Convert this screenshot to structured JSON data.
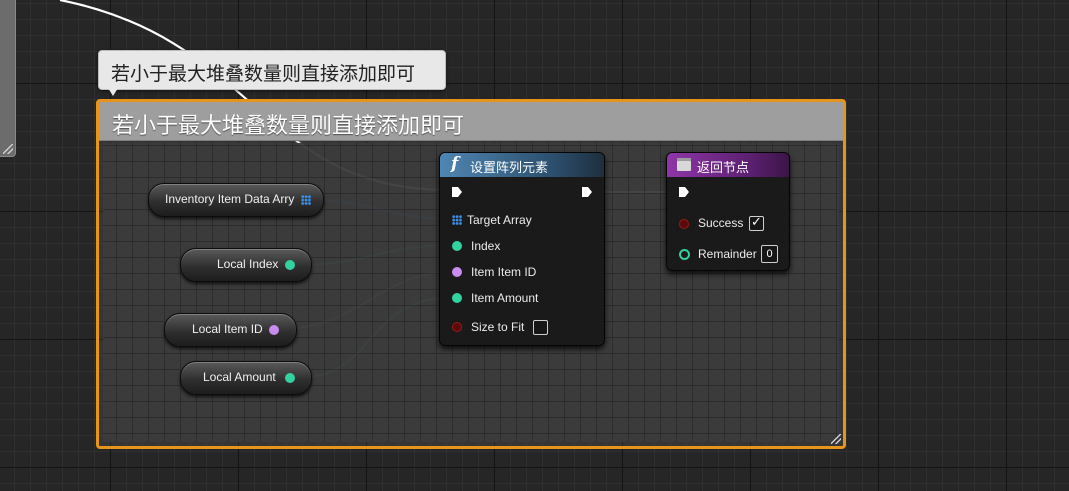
{
  "comment": {
    "bubble_text": "若小于最大堆叠数量则直接添加即可",
    "header_text": "若小于最大堆叠数量则直接添加即可",
    "frame_color": "#e6951c"
  },
  "variables": [
    {
      "label": "Inventory Item Data Arry",
      "pin_type": "array",
      "color": "#3b8fe6"
    },
    {
      "label": "Local Index",
      "pin_type": "integer",
      "color": "#34d1a0"
    },
    {
      "label": "Local Item ID",
      "pin_type": "byte",
      "color": "#c88cf0"
    },
    {
      "label": "Local Amount",
      "pin_type": "integer",
      "color": "#34d1a0"
    }
  ],
  "set_array_elem_node": {
    "title": "设置阵列元素",
    "icon": "function-icon",
    "header_color": "#3e6e96",
    "pins": [
      "Target Array",
      "Index",
      "Item Item ID",
      "Item Amount",
      "Size to Fit"
    ],
    "size_to_fit": false
  },
  "return_node": {
    "title": "返回节点",
    "icon": "return-node-icon",
    "header_color": "#7b2d91",
    "pins": [
      "Success",
      "Remainder"
    ],
    "success_checked": true,
    "remainder_value": "0"
  }
}
